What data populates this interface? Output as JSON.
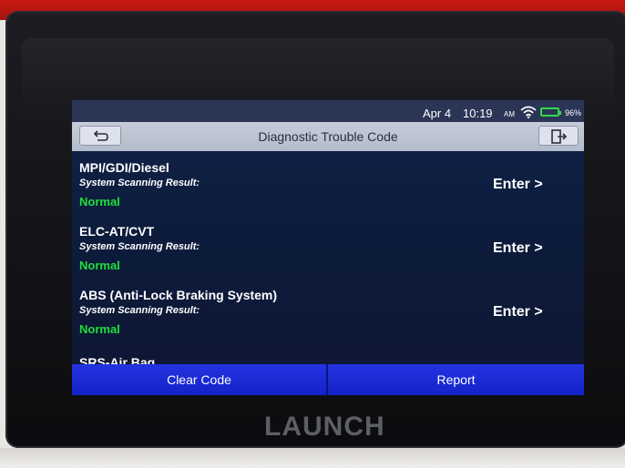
{
  "status_bar": {
    "date": "Apr 4",
    "time": "10:19",
    "ampm": "AM",
    "battery": "96%"
  },
  "header": {
    "title": "Diagnostic Trouble Code"
  },
  "systems": [
    {
      "name": "MPI/GDI/Diesel",
      "subtitle": "System Scanning Result:",
      "result": "Normal",
      "action": "Enter >"
    },
    {
      "name": "ELC-AT/CVT",
      "subtitle": "System Scanning Result:",
      "result": "Normal",
      "action": "Enter >"
    },
    {
      "name": "ABS (Anti-Lock Braking System)",
      "subtitle": "System Scanning Result:",
      "result": "Normal",
      "action": "Enter >"
    },
    {
      "name": "SRS-Air Bag"
    }
  ],
  "actions": {
    "clear": "Clear Code",
    "report": "Report"
  },
  "brand": "LAUNCH",
  "colors": {
    "result_normal": "#1ee03a",
    "action_bar": "#1a2ad8",
    "title_bar": "#bcc3d2",
    "screen_bg": "#0f1f42",
    "battery": "#30d94a"
  }
}
